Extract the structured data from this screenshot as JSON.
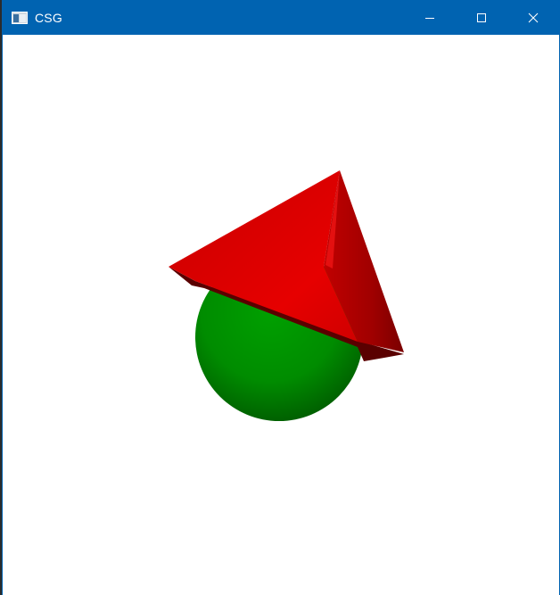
{
  "window": {
    "title": "CSG",
    "icon": "app-window-icon",
    "controls": {
      "minimize_icon": "minimize-icon",
      "maximize_icon": "maximize-icon",
      "close_icon": "close-icon"
    },
    "titlebar_color": "#0063b1"
  },
  "scene": {
    "background": "#ffffff",
    "objects": [
      {
        "name": "cone",
        "color": "#e00000"
      },
      {
        "name": "sphere",
        "color": "#009000"
      }
    ]
  }
}
